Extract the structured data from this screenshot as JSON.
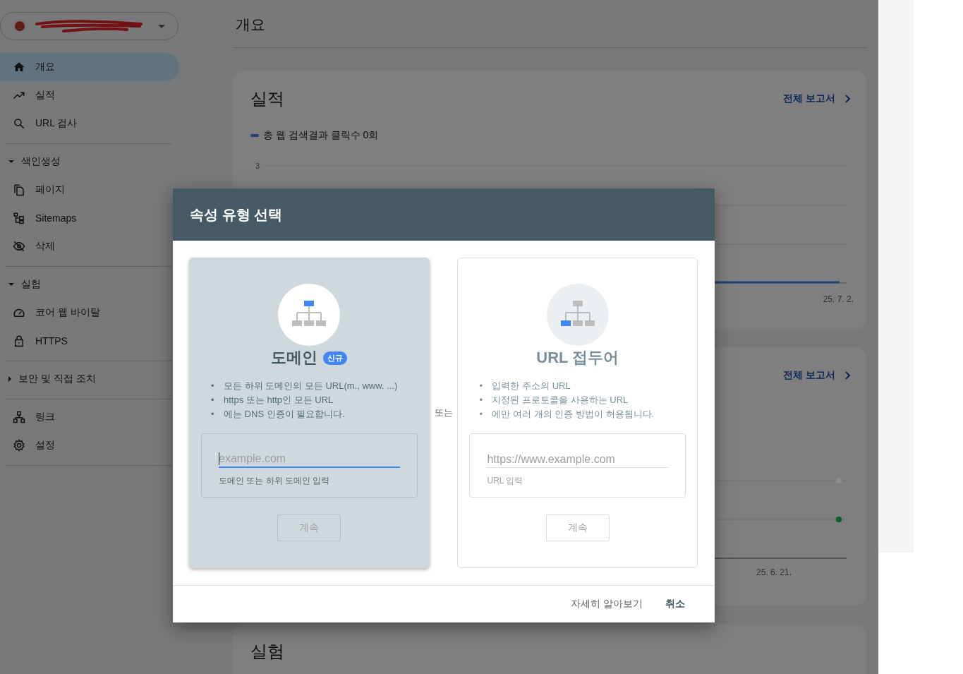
{
  "sidebar": {
    "groups": [
      {
        "items": [
          {
            "label": "개요",
            "selected": true
          },
          {
            "label": "실적",
            "selected": false
          },
          {
            "label": "URL 검사",
            "selected": false
          }
        ]
      },
      {
        "title": "색인생성",
        "expanded": true,
        "items": [
          {
            "label": "페이지",
            "selected": false
          },
          {
            "label": "Sitemaps",
            "selected": false
          },
          {
            "label": "삭제",
            "selected": false
          }
        ]
      },
      {
        "title": "실험",
        "expanded": true,
        "items": [
          {
            "label": "코어 웹 바이탈",
            "selected": false
          },
          {
            "label": "HTTPS",
            "selected": false
          }
        ]
      },
      {
        "title": "보안 및 직접 조치",
        "expanded": false
      },
      {
        "items": [
          {
            "label": "링크",
            "selected": false
          },
          {
            "label": "설정",
            "selected": false
          }
        ]
      }
    ]
  },
  "page_title": "개요",
  "performance": {
    "title": "실적",
    "link": "전체 보고서",
    "legend": "총 웹 검색결과 클릭수 0회",
    "y_tick": "3",
    "x_label": "25. 7. 2."
  },
  "second_card": {
    "link": "전체 보고서",
    "x_label": "25. 6. 21.",
    "points": [
      {
        "color": "#8c8c8c"
      },
      {
        "color": "#0b5e2c"
      }
    ]
  },
  "experiments_card": {
    "title": "실험"
  },
  "dialog": {
    "title": "속성 유형 선택",
    "separator": "또는",
    "options": [
      {
        "title": "도메인",
        "badge": "신규",
        "selected": true,
        "marker": "•",
        "bullets": [
          "모든 하위 도메인의 모든 URL(m., www. ...)",
          "https 또는 http인 모든 URL",
          "에는 DNS 인증이 필요합니다."
        ],
        "field": {
          "placeholder": "example.com",
          "focused": true
        },
        "helper": "도메인 또는 하위 도메인 입력",
        "button": "계속"
      },
      {
        "title": "URL 접두어",
        "selected": false,
        "marker": "•",
        "bullets": [
          "입력한 주소의 URL",
          "지정된 프로토콜을 사용하는 URL",
          "에만 여러 개의 인증 방법이 허용됩니다."
        ],
        "field": {
          "placeholder": "https://www.example.com",
          "focused": false
        },
        "helper": "URL 입력",
        "button": "계속"
      }
    ],
    "actions": [
      {
        "label": "자세히 알아보기",
        "kind": "secondary"
      },
      {
        "label": "취소",
        "kind": "primary"
      }
    ]
  }
}
